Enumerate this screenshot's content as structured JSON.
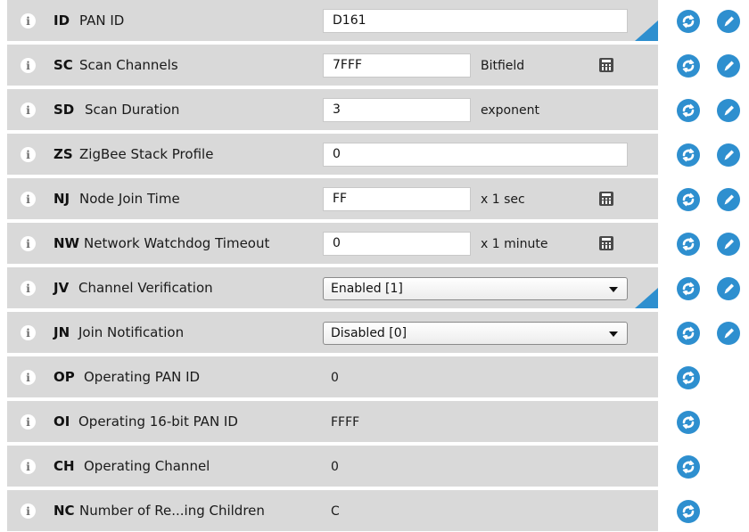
{
  "settings": [
    {
      "code": "ID",
      "label": "PAN ID",
      "kind": "text",
      "value": "D161",
      "modified": true,
      "writable": true
    },
    {
      "code": "SC",
      "label": "Scan Channels",
      "kind": "text-unit",
      "value": "7FFF",
      "unit": "Bitfield",
      "calculator": true,
      "writable": true
    },
    {
      "code": "SD",
      "label": "Scan Duration",
      "kind": "text-unit",
      "value": "3",
      "unit": "exponent",
      "calculator": false,
      "writable": true
    },
    {
      "code": "ZS",
      "label": "ZigBee Stack Profile",
      "kind": "text",
      "value": "0",
      "writable": true
    },
    {
      "code": "NJ",
      "label": "Node Join Time",
      "kind": "text-unit",
      "value": "FF",
      "unit": "x 1 sec",
      "calculator": true,
      "writable": true
    },
    {
      "code": "NW",
      "label": "Network Watchdog Timeout",
      "kind": "text-unit",
      "value": "0",
      "unit": "x 1 minute",
      "calculator": true,
      "writable": true
    },
    {
      "code": "JV",
      "label": "Channel Verification",
      "kind": "select",
      "value": "Enabled [1]",
      "modified": true,
      "writable": true
    },
    {
      "code": "JN",
      "label": "Join Notification",
      "kind": "select",
      "value": "Disabled [0]",
      "writable": true
    },
    {
      "code": "OP",
      "label": "Operating PAN ID",
      "kind": "readonly",
      "value": "0",
      "writable": false
    },
    {
      "code": "OI",
      "label": "Operating 16-bit PAN ID",
      "kind": "readonly",
      "value": "FFFF",
      "writable": false
    },
    {
      "code": "CH",
      "label": "Operating Channel",
      "kind": "readonly",
      "value": "0",
      "writable": false
    },
    {
      "code": "NC",
      "label": "Number of Re...ing Children",
      "kind": "readonly",
      "value": "C",
      "writable": false
    }
  ],
  "icons": {
    "info": "info-icon",
    "read": "refresh-icon",
    "write": "pencil-icon",
    "calculator": "calculator-icon"
  },
  "colors": {
    "row_background": "#d9d9d9",
    "accent": "#2e8fcf"
  }
}
